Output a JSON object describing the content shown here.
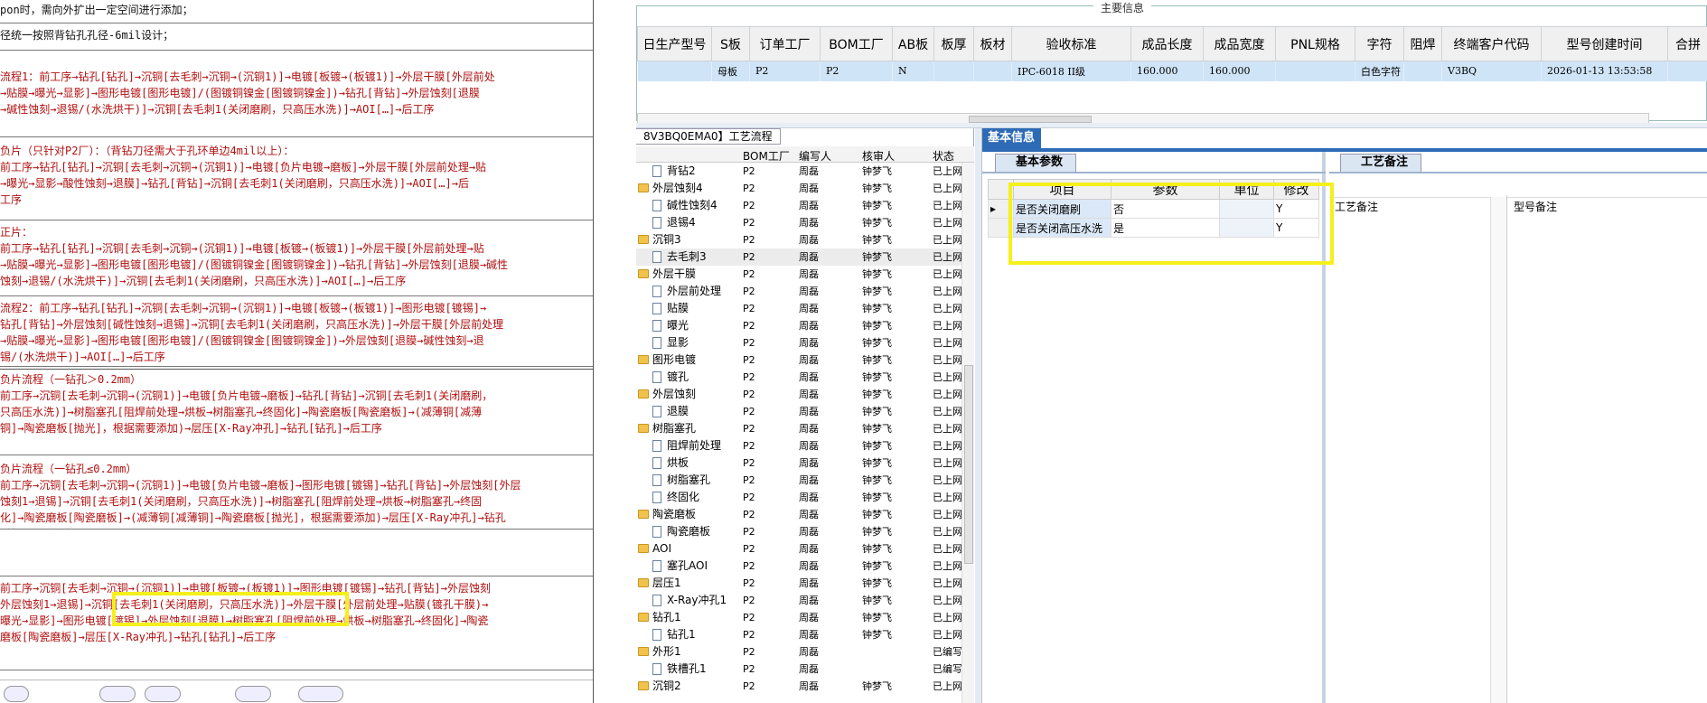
{
  "document": {
    "lines": [
      [
        "pon时，需向外扩出一定空间进行添加；"
      ],
      [
        "径统一按照背钻孔孔径-6mil设计；"
      ],
      [
        "流程1：前工序→钻孔[钻孔]→沉铜[去毛刺→沉铜→(沉铜1)]→电镀[板镀→(板镀1)]→外层干膜[外层前处",
        "→贴膜→曝光→显影]→图形电镀[图形电镀]/(图镀铜镍金[图镀铜镍金])→钻孔[背钻]→外层蚀刻[退膜",
        "→碱性蚀刻→退锡/(水洗烘干)]→沉铜[去毛刺1(关闭磨刷，只高压水洗)]→AOI[…]→后工序"
      ],
      [
        "负片（只针对P2厂）：（背钻刀径需大于孔环单边4mil以上）：",
        "前工序→钻孔[钻孔]→沉铜[去毛刺→沉铜→(沉铜1)]→电镀[负片电镀→磨板]→外层干膜[外层前处理→贴",
        "→曝光→显影→酸性蚀刻→退膜]→钻孔[背钻]→沉铜[去毛刺1(关闭磨刷，只高压水洗)]→AOI[…]→后",
        "工序"
      ],
      [
        "正片：",
        "前工序→钻孔[钻孔]→沉铜[去毛刺→沉铜→(沉铜1)]→电镀[板镀→(板镀1)]→外层干膜[外层前处理→贴",
        "→贴膜→曝光→显影]→图形电镀[图形电镀]/(图镀铜镍金[图镀铜镍金])→钻孔[背钻]→外层蚀刻[退膜→碱性",
        "蚀刻→退锡/(水洗烘干)]→沉铜[去毛刺1(关闭磨刷，只高压水洗)]→AOI[…]→后工序"
      ],
      [
        "流程2：前工序→钻孔[钻孔]→沉铜[去毛刺→沉铜→(沉铜1)]→电镀[板镀→(板镀1)]→图形电镀[镀锡]→",
        "钻孔[背钻]→外层蚀刻[碱性蚀刻→退锡]→沉铜[去毛刺1(关闭磨刷，只高压水洗)]→外层干膜[外层前处理",
        "→贴膜→曝光→显影]→图形电镀[图形电镀]/(图镀铜镍金[图镀铜镍金])→外层蚀刻[退膜→碱性蚀刻→退",
        "锡/(水洗烘干)]→AOI[…]→后工序"
      ],
      [
        "负片流程（一钻孔＞0.2mm）",
        "前工序→沉铜[去毛刺→沉铜→(沉铜1)]→电镀[负片电镀→磨板]→钻孔[背钻]→沉铜[去毛刺1(关闭磨刷，",
        "只高压水洗)]→树脂塞孔[阻焊前处理→烘板→树脂塞孔→终固化]→陶瓷磨板[陶瓷磨板]→(减薄铜[减薄",
        "铜]→陶瓷磨板[抛光]，根据需要添加)→层压[X-Ray冲孔]→钻孔[钻孔]→后工序"
      ],
      [
        "负片流程（一钻孔≤0.2mm）",
        "前工序→沉铜[去毛刺→沉铜→(沉铜1)]→电镀[负片电镀→磨板]→图形电镀[镀锡]→钻孔[背钻]→外层蚀刻[外层",
        "蚀刻1→退锡]→沉铜[去毛刺1(关闭磨刷，只高压水洗)]→树脂塞孔[阻焊前处理→烘板→树脂塞孔→终固",
        "化]→陶瓷磨板[陶瓷磨板]→(减薄铜[减薄铜]→陶瓷磨板[抛光]，根据需要添加)→层压[X-Ray冲孔]→钻孔",
        "[钻孔]→后工序"
      ],
      [
        ""
      ],
      [
        "前工序→沉铜[去毛刺→沉铜→(沉铜1)]→电镀[板镀→(板镀1)]→图形电镀[镀锡]→钻孔[背钻]→外层蚀刻",
        "外层蚀刻1→退锡]→沉铜[去毛刺1(关闭磨刷，只高压水洗)]→外层干膜[外层前处理→贴膜(镀孔干膜)→",
        "曝光→显影]→图形电镀[镀锡]→外层蚀刻[退膜]→树脂塞孔[阻焊前处理→烘板→树脂塞孔→终固化]→陶瓷",
        "磨板[陶瓷磨板]→层压[X-Ray冲孔]→钻孔[钻孔]→后工序"
      ],
      [
        ""
      ]
    ]
  },
  "main_info": {
    "caption": "主要信息",
    "columns": [
      "日生产型号",
      "S板",
      "订单工厂",
      "BOM工厂",
      "AB板",
      "板厚",
      "板材",
      "验收标准",
      "成品长度",
      "成品宽度",
      "PNL规格",
      "字符",
      "阻焊",
      "终端客户代码",
      "型号创建时间",
      "合拼"
    ],
    "row": [
      "",
      "母板",
      "P2",
      "P2",
      "N",
      "",
      "",
      "IPC-6018 II级",
      "160.000",
      "160.000",
      "",
      "白色字符",
      "",
      "V3BQ",
      "2026-01-13 13:53:58",
      ""
    ]
  },
  "process_tree": {
    "tab_label": "8V3BQ0EMA0】工艺流程",
    "headers": [
      "BOM工厂",
      "编写人",
      "核审人",
      "状态"
    ],
    "rows": [
      {
        "name": "背钻2",
        "kind": "doc",
        "bom": "P2",
        "author": "周磊",
        "reviewer": "钟梦飞",
        "status": "已上网"
      },
      {
        "name": "外层蚀刻4",
        "kind": "folder",
        "bom": "P2",
        "author": "周磊",
        "reviewer": "钟梦飞",
        "status": "已上网"
      },
      {
        "name": "碱性蚀刻4",
        "kind": "doc",
        "bom": "P2",
        "author": "周磊",
        "reviewer": "钟梦飞",
        "status": "已上网"
      },
      {
        "name": "退锡4",
        "kind": "doc",
        "bom": "P2",
        "author": "周磊",
        "reviewer": "钟梦飞",
        "status": "已上网"
      },
      {
        "name": "沉铜3",
        "kind": "folder",
        "bom": "P2",
        "author": "周磊",
        "reviewer": "钟梦飞",
        "status": "已上网"
      },
      {
        "name": "去毛刺3",
        "kind": "doc",
        "bom": "P2",
        "author": "周磊",
        "reviewer": "钟梦飞",
        "status": "已上网",
        "selected": true
      },
      {
        "name": "外层干膜",
        "kind": "folder",
        "bom": "P2",
        "author": "周磊",
        "reviewer": "钟梦飞",
        "status": "已上网"
      },
      {
        "name": "外层前处理",
        "kind": "doc",
        "bom": "P2",
        "author": "周磊",
        "reviewer": "钟梦飞",
        "status": "已上网"
      },
      {
        "name": "贴膜",
        "kind": "doc",
        "bom": "P2",
        "author": "周磊",
        "reviewer": "钟梦飞",
        "status": "已上网"
      },
      {
        "name": "曝光",
        "kind": "doc",
        "bom": "P2",
        "author": "周磊",
        "reviewer": "钟梦飞",
        "status": "已上网"
      },
      {
        "name": "显影",
        "kind": "doc",
        "bom": "P2",
        "author": "周磊",
        "reviewer": "钟梦飞",
        "status": "已上网"
      },
      {
        "name": "图形电镀",
        "kind": "folder",
        "bom": "P2",
        "author": "周磊",
        "reviewer": "钟梦飞",
        "status": "已上网"
      },
      {
        "name": "镀孔",
        "kind": "doc",
        "bom": "P2",
        "author": "周磊",
        "reviewer": "钟梦飞",
        "status": "已上网"
      },
      {
        "name": "外层蚀刻",
        "kind": "folder",
        "bom": "P2",
        "author": "周磊",
        "reviewer": "钟梦飞",
        "status": "已上网"
      },
      {
        "name": "退膜",
        "kind": "doc",
        "bom": "P2",
        "author": "周磊",
        "reviewer": "钟梦飞",
        "status": "已上网"
      },
      {
        "name": "树脂塞孔",
        "kind": "folder",
        "bom": "P2",
        "author": "周磊",
        "reviewer": "钟梦飞",
        "status": "已上网"
      },
      {
        "name": "阻焊前处理",
        "kind": "doc",
        "bom": "P2",
        "author": "周磊",
        "reviewer": "钟梦飞",
        "status": "已上网"
      },
      {
        "name": "烘板",
        "kind": "doc",
        "bom": "P2",
        "author": "周磊",
        "reviewer": "钟梦飞",
        "status": "已上网"
      },
      {
        "name": "树脂塞孔",
        "kind": "doc",
        "bom": "P2",
        "author": "周磊",
        "reviewer": "钟梦飞",
        "status": "已上网"
      },
      {
        "name": "终固化",
        "kind": "doc",
        "bom": "P2",
        "author": "周磊",
        "reviewer": "钟梦飞",
        "status": "已上网"
      },
      {
        "name": "陶瓷磨板",
        "kind": "folder",
        "bom": "P2",
        "author": "周磊",
        "reviewer": "钟梦飞",
        "status": "已上网"
      },
      {
        "name": "陶瓷磨板",
        "kind": "doc",
        "bom": "P2",
        "author": "周磊",
        "reviewer": "钟梦飞",
        "status": "已上网"
      },
      {
        "name": "AOI",
        "kind": "folder",
        "bom": "P2",
        "author": "周磊",
        "reviewer": "钟梦飞",
        "status": "已上网"
      },
      {
        "name": "塞孔AOI",
        "kind": "doc",
        "bom": "P2",
        "author": "周磊",
        "reviewer": "钟梦飞",
        "status": "已上网"
      },
      {
        "name": "层压1",
        "kind": "folder",
        "bom": "P2",
        "author": "周磊",
        "reviewer": "钟梦飞",
        "status": "已上网"
      },
      {
        "name": "X-Ray冲孔1",
        "kind": "doc",
        "bom": "P2",
        "author": "周磊",
        "reviewer": "钟梦飞",
        "status": "已上网"
      },
      {
        "name": "钻孔1",
        "kind": "folder",
        "bom": "P2",
        "author": "周磊",
        "reviewer": "钟梦飞",
        "status": "已上网"
      },
      {
        "name": "钻孔1",
        "kind": "doc",
        "bom": "P2",
        "author": "周磊",
        "reviewer": "钟梦飞",
        "status": "已上网"
      },
      {
        "name": "外形1",
        "kind": "folder",
        "bom": "P2",
        "author": "周磊",
        "reviewer": "",
        "status": "已编写"
      },
      {
        "name": "铁槽孔1",
        "kind": "doc",
        "bom": "P2",
        "author": "周磊",
        "reviewer": "",
        "status": "已编写"
      },
      {
        "name": "沉铜2",
        "kind": "folder",
        "bom": "P2",
        "author": "周磊",
        "reviewer": "钟梦飞",
        "status": "已上网"
      }
    ]
  },
  "basic_info": {
    "title": "基本信息",
    "params_tab": "基本参数",
    "notes_tab": "工艺备注",
    "param_headers": [
      "项目",
      "参数",
      "单位",
      "修改"
    ],
    "params": [
      {
        "item": "是否关闭磨刷",
        "value": "否",
        "unit": "",
        "modify": "Y"
      },
      {
        "item": "是否关闭高压水洗",
        "value": "是",
        "unit": "",
        "modify": "Y"
      }
    ],
    "notes_headers": [
      "工艺备注",
      "型号备注"
    ]
  }
}
